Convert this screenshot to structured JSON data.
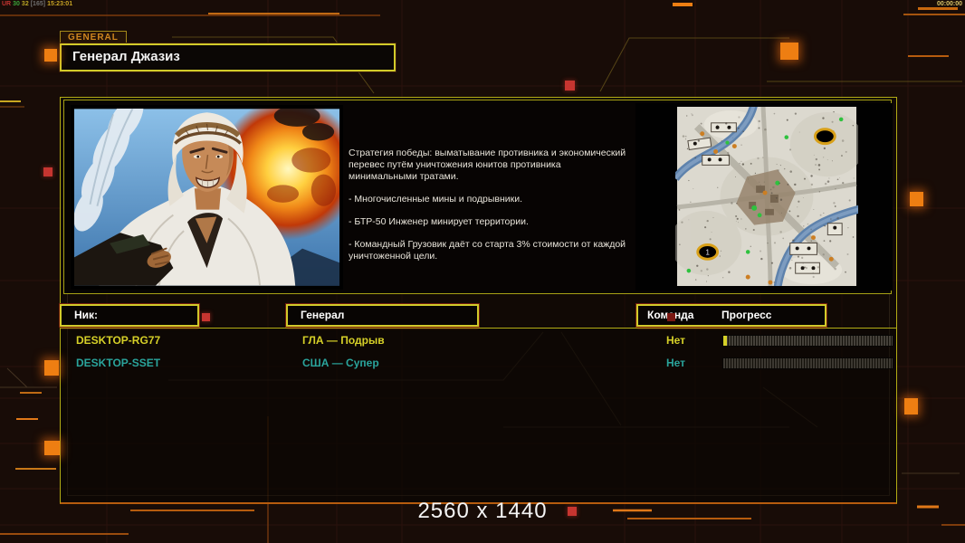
{
  "hud": {
    "debug": [
      {
        "text": "UR"
      },
      {
        "text": "30"
      },
      {
        "text": "32"
      },
      {
        "text": "[165]"
      },
      {
        "text": "15:23:01"
      }
    ],
    "match_timer": "00:00:00"
  },
  "general_panel": {
    "tab_label": "GENERAL",
    "name_value": "Генерал Джазиз"
  },
  "description": {
    "paragraphs": [
      "Стратегия победы: выматывание противника и экономический перевес путём уничтожения юнитов противника минимальными тратами.",
      "- Многочисленные мины и подрывники.",
      "- БТР-50 Инженер минирует территории.",
      "- Командный Грузовик даёт со старта 3% стоимости от каждой уничтоженной цели."
    ]
  },
  "map_preview": {
    "start_marker_label": "1"
  },
  "players_table": {
    "headers": {
      "nick": "Ник:",
      "general": "Генерал",
      "team": "Команда",
      "progress": "Прогресс"
    },
    "rows": [
      {
        "nick": "DESKTOP-RG77",
        "general": "ГЛА — Подрыв",
        "team": "Нет",
        "progress_percent": 2,
        "color": "#d6d028"
      },
      {
        "nick": "DESKTOP-SSET",
        "general": "США — Супер",
        "team": "Нет",
        "progress_percent": 0,
        "color": "#2aa49c"
      }
    ]
  },
  "footer": {
    "resolution_label": "2560 x 1440"
  },
  "colors": {
    "accent_yellow": "#d2cb2a",
    "accent_orange": "#e07818",
    "row_yellow": "#d6d028",
    "row_teal": "#2aa49c",
    "background": "#180c07"
  }
}
